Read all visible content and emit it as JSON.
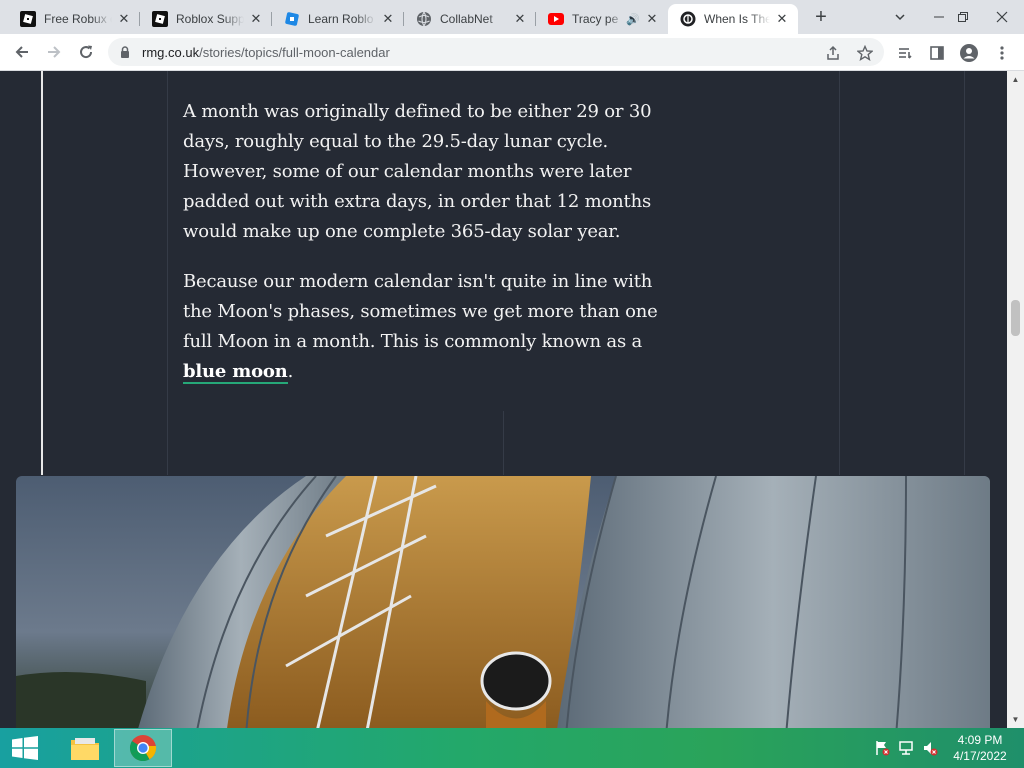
{
  "browser": {
    "tabs": [
      {
        "title": "Free Robux o",
        "icon": "roblox-icon",
        "active": false
      },
      {
        "title": "Roblox Supp",
        "icon": "roblox-icon",
        "active": false
      },
      {
        "title": "Learn Roblo",
        "icon": "roblox-studio-icon",
        "active": false
      },
      {
        "title": "CollabNet",
        "icon": "globe-icon",
        "active": false
      },
      {
        "title": "Tracy pe",
        "icon": "youtube-icon",
        "active": false,
        "audio": "🔊"
      },
      {
        "title": "When Is The",
        "icon": "rmg-icon",
        "active": true
      }
    ],
    "close_glyph": "✕",
    "new_tab_glyph": "+",
    "address": {
      "domain": "rmg.co.uk",
      "path": "/stories/topics/full-moon-calendar"
    }
  },
  "article": {
    "paragraph1": "A month was originally defined to be either 29 or 30 days, roughly equal to the 29.5-day lunar cycle. However, some of our calendar months were later padded out with extra days, in order that 12 months would make up one complete 365-day solar year.",
    "paragraph2_text": "Because our modern calendar isn't quite in line with the Moon's phases, sometimes we get more than one full Moon in a month. This is commonly known as a ",
    "paragraph2_link": "blue moon",
    "paragraph2_end": "."
  },
  "taskbar": {
    "time": "4:09 PM",
    "date": "4/17/2022"
  },
  "colors": {
    "page_bg": "#252a34",
    "link_underline": "#26a878",
    "taskbar_start": "#18a0a0",
    "taskbar_end": "#2aa35a"
  }
}
